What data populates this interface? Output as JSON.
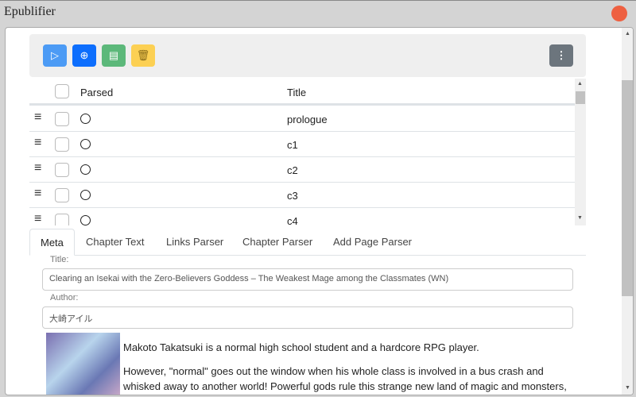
{
  "window": {
    "title": "Epublifier"
  },
  "toolbar": {
    "buttons": [
      {
        "icon": "play-icon",
        "color": "#4c9bf5"
      },
      {
        "icon": "plus-circle-icon",
        "color": "#0d6efd"
      },
      {
        "icon": "book-icon",
        "color": "#5cb87a"
      },
      {
        "icon": "trash-icon",
        "color": "#fcd053"
      }
    ],
    "more_icon": "kebab-icon"
  },
  "table": {
    "headers": {
      "parsed": "Parsed",
      "title": "Title"
    },
    "rows": [
      {
        "title": "prologue"
      },
      {
        "title": "c1"
      },
      {
        "title": "c2"
      },
      {
        "title": "c3"
      },
      {
        "title": "c4"
      }
    ]
  },
  "tabs": [
    "Meta",
    "Chapter Text",
    "Links Parser",
    "Chapter Parser",
    "Add Page Parser"
  ],
  "meta": {
    "title_label": "Title:",
    "title_value": "Clearing an Isekai with the Zero-Believers Goddess – The Weakest Mage among the Classmates (WN)",
    "author_label": "Author:",
    "author_value": "大崎アイル",
    "description": [
      "Makoto Takatsuki is a normal high school student and a hardcore RPG player.",
      "However, \"normal\" goes out the window when his whole class is involved in a bus crash and whisked away to another world! Powerful gods rule this strange new land of magic and monsters,"
    ]
  }
}
